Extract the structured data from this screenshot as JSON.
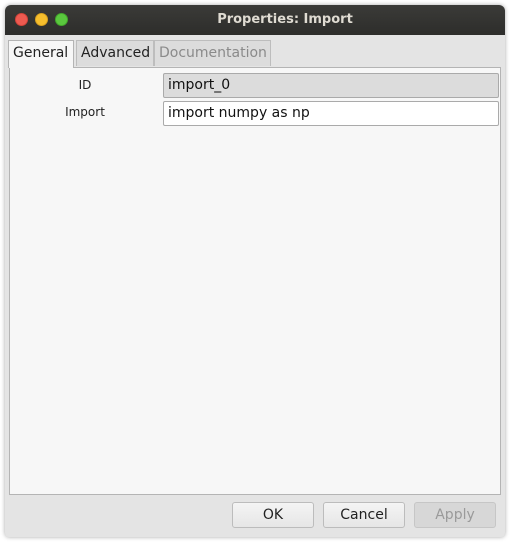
{
  "window": {
    "title": "Properties: Import"
  },
  "tabs": [
    {
      "label": "General",
      "active": true,
      "enabled": true
    },
    {
      "label": "Advanced",
      "active": false,
      "enabled": true
    },
    {
      "label": "Documentation",
      "active": false,
      "enabled": false
    }
  ],
  "form": {
    "id_label": "ID",
    "id_value": "import_0",
    "import_label": "Import",
    "import_value": "import numpy as np"
  },
  "buttons": {
    "ok": "OK",
    "cancel": "Cancel",
    "apply": "Apply"
  },
  "colors": {
    "close": "#ed5a50",
    "minimize": "#f6be2d",
    "maximize": "#5ac73e",
    "titlebar": "#2d2d2b"
  }
}
